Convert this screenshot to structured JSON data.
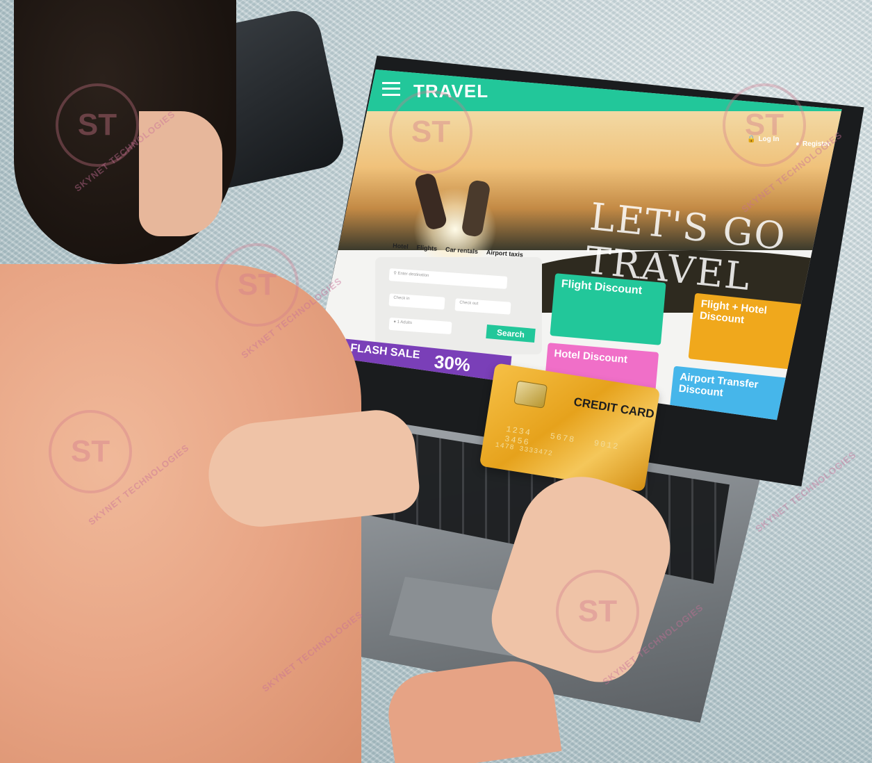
{
  "site": {
    "brand": "TRAVEL",
    "login": "Log In",
    "register": "Register",
    "hero_title": "LET'S GO TRAVEL",
    "tabs": [
      "Hotel",
      "Flights",
      "Car rentals",
      "Airport taxis"
    ],
    "fields": {
      "destination": "Enter destination",
      "check_in_label": "Check in",
      "check_out_label": "Check out",
      "guests": "1 Adults"
    },
    "search_button": "Search",
    "flash_sale": {
      "label": "FLASH SALE",
      "percent": "30%"
    },
    "promo_cards": [
      {
        "title": "Flight Discount",
        "color": "#22c79a"
      },
      {
        "title": "Flight + Hotel Discount",
        "color": "#f0a81c"
      },
      {
        "title": "Hotel Discount",
        "color": "#f06fc8"
      },
      {
        "title": "Airport Transfer Discount",
        "color": "#46b6ea"
      }
    ],
    "brand_color": "#22c79a"
  },
  "credit_card": {
    "title": "CREDIT CARD",
    "number": "1234  5678  9012  3456",
    "secondary": "1478 3333472"
  },
  "watermark": {
    "logo": "ST",
    "text": "SKYNET TECHNOLOGIES"
  }
}
